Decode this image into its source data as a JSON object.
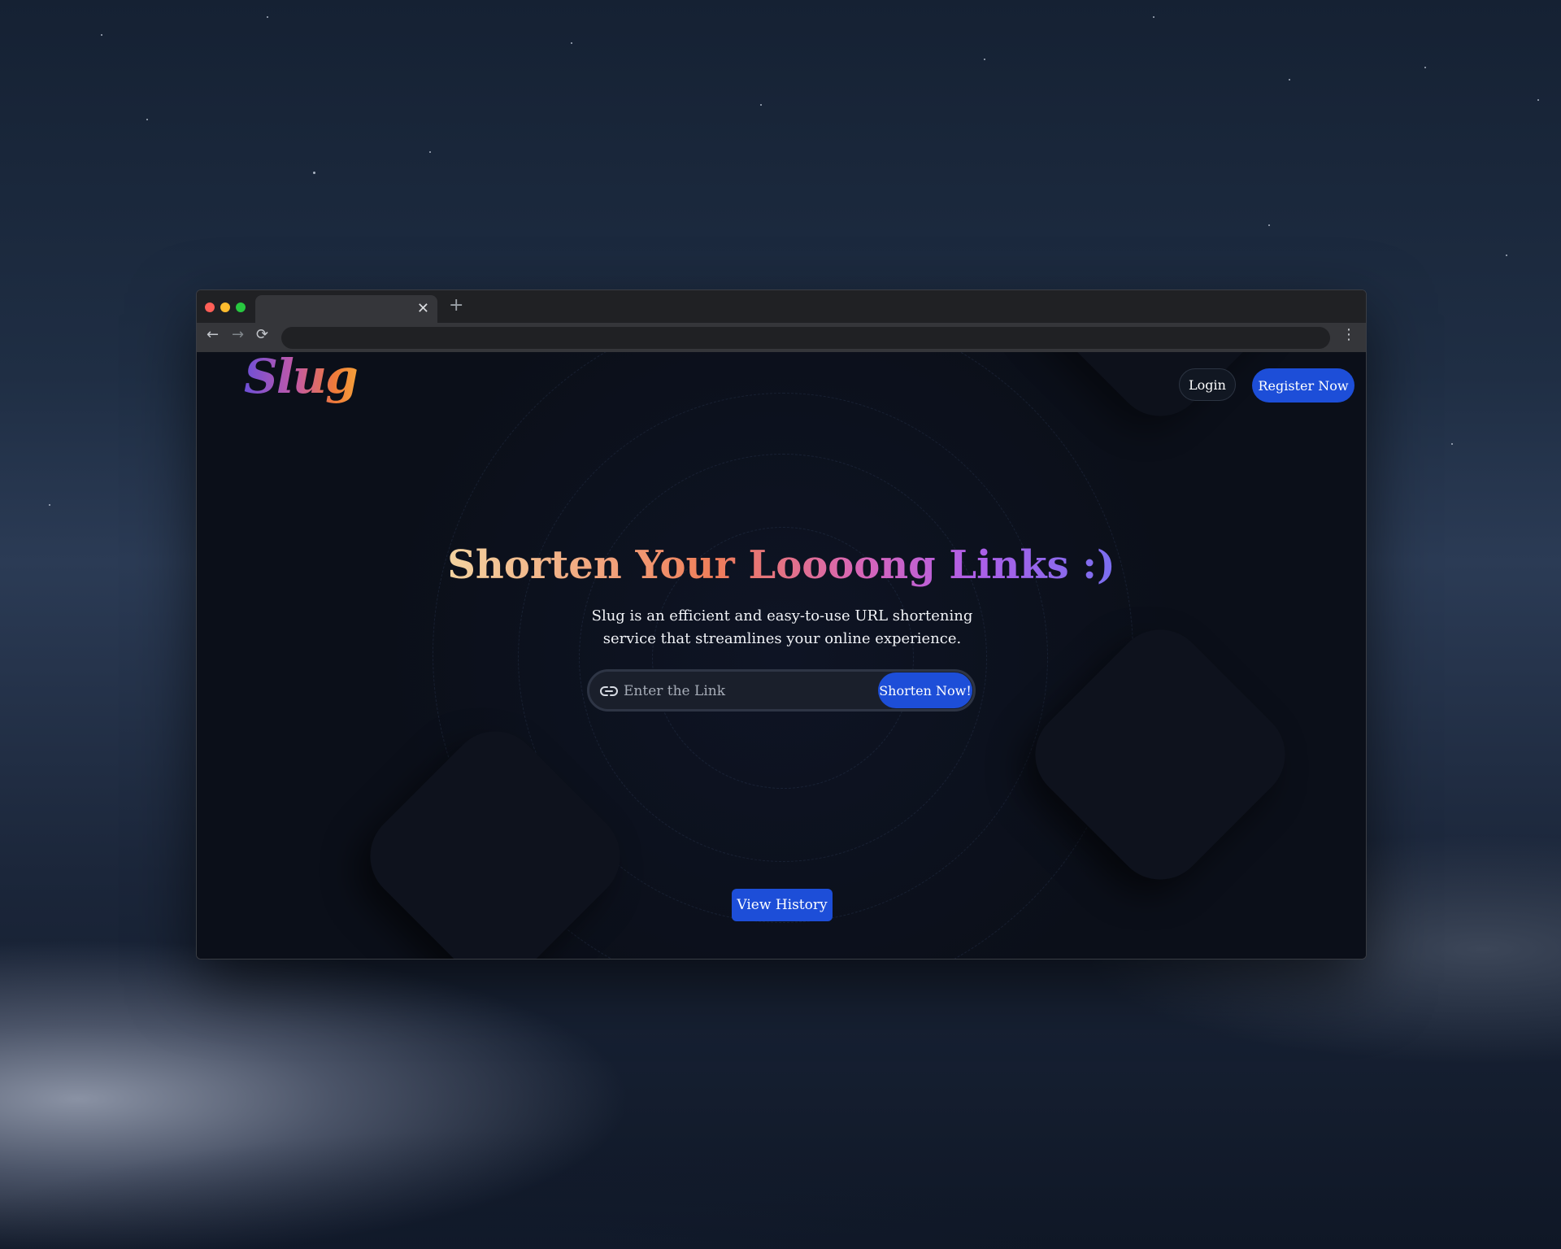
{
  "desktop": {
    "wallpaper": "macOS Mojave night"
  },
  "browser": {
    "tab": {
      "title": "",
      "close_icon": "close-icon"
    },
    "new_tab_label": "+",
    "address_bar": {
      "value": ""
    },
    "colors": {
      "close": "#ff5f57",
      "minimize": "#febc2e",
      "maximize": "#28c840"
    }
  },
  "header": {
    "logo_text": "Slug",
    "login_label": "Login",
    "register_label": "Register Now"
  },
  "hero": {
    "title": "Shorten Your Loooong Links :)",
    "subtitle": "Slug is an efficient and easy-to-use URL shortening service that streamlines your online experience."
  },
  "form": {
    "icon": "link-icon",
    "placeholder": "Enter the Link",
    "value": "",
    "submit_label": "Shorten Now!"
  },
  "footer": {
    "history_label": "View History"
  },
  "theme": {
    "accent": "#1d4ed8",
    "background": "#0b0f19"
  }
}
